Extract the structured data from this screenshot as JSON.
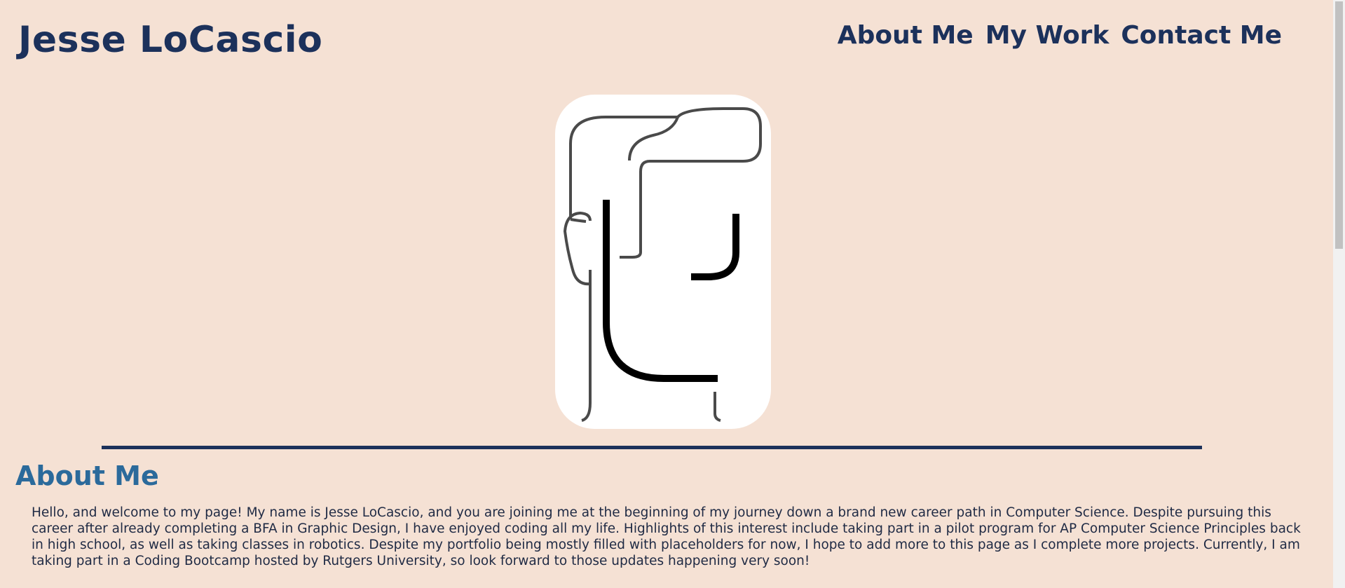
{
  "header": {
    "site_title": "Jesse LoCascio",
    "nav": [
      {
        "label": "About Me"
      },
      {
        "label": "My Work"
      },
      {
        "label": "Contact Me"
      }
    ]
  },
  "hero": {
    "image": "line-art-face-portrait"
  },
  "about": {
    "heading": "About Me",
    "body": "Hello, and welcome to my page! My name is Jesse LoCascio, and you are joining me at the beginning of my journey down a brand new career path in Computer Science. Despite pursuing this career after already completing a BFA in Graphic Design, I have enjoyed coding all my life. Highlights of this interest include taking part in a pilot program for AP Computer Science Principles back in high school, as well as taking classes in robotics. Despite my portfolio being mostly filled with placeholders for now, I hope to add more to this page as I complete more projects. Currently, I am taking part in a Coding Bootcamp hosted by Rutgers University, so look forward to those updates happening very soon!"
  },
  "colors": {
    "background": "#f5e1d4",
    "primary_navy": "#1c315b",
    "heading_blue": "#2b6a9b",
    "card": "#ffffff"
  }
}
